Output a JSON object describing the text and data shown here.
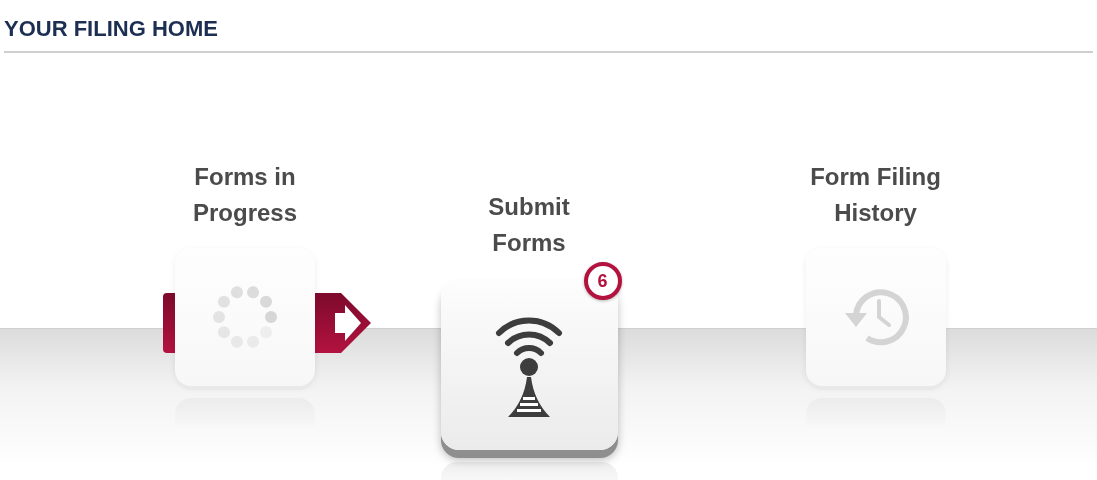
{
  "header": {
    "title": "YOUR FILING HOME"
  },
  "items": [
    {
      "label": "Forms in Progress",
      "kind": "progress",
      "selected": false
    },
    {
      "label": "Submit Forms",
      "kind": "submit",
      "selected": true,
      "badge": "6"
    },
    {
      "label": "Form Filing History",
      "kind": "history",
      "selected": false
    }
  ]
}
